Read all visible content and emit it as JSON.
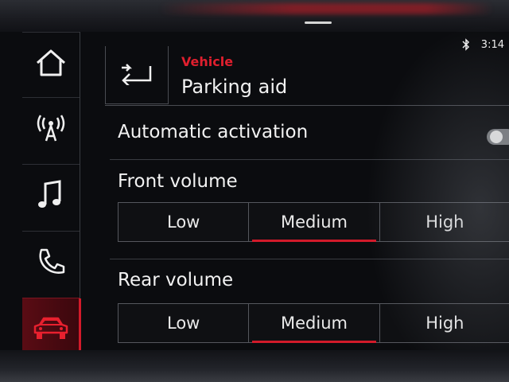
{
  "status_bar": {
    "time": "3:14"
  },
  "sidebar": {
    "items": [
      {
        "icon": "home-icon"
      },
      {
        "icon": "radio-icon"
      },
      {
        "icon": "music-icon"
      },
      {
        "icon": "phone-icon"
      },
      {
        "icon": "car-icon",
        "active": true
      }
    ]
  },
  "header": {
    "breadcrumb": "Vehicle",
    "title": "Parking aid"
  },
  "settings": {
    "auto_activation_label": "Automatic activation",
    "auto_activation_on": false,
    "front_volume": {
      "label": "Front volume",
      "options": [
        "Low",
        "Medium",
        "High"
      ],
      "selected": "Medium"
    },
    "rear_volume": {
      "label": "Rear volume",
      "options": [
        "Low",
        "Medium",
        "High"
      ],
      "selected": "Medium"
    }
  },
  "colors": {
    "accent": "#d21a2a",
    "active_bg": "#5a0c14"
  }
}
